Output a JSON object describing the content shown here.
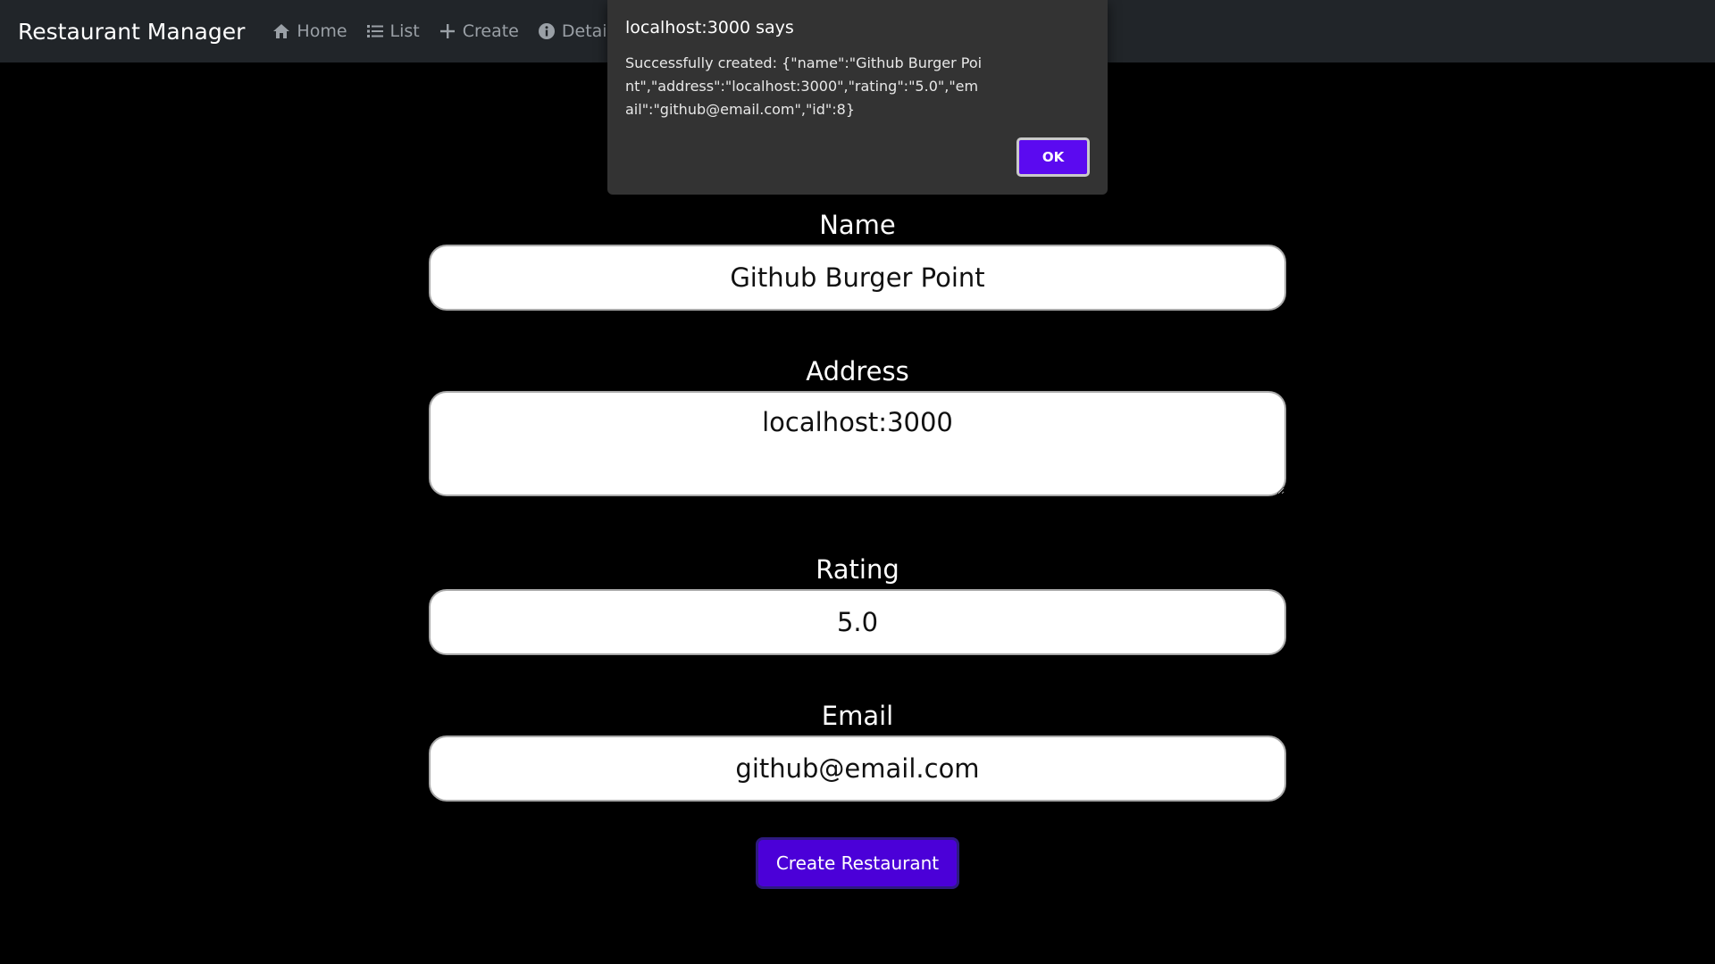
{
  "navbar": {
    "brand": "Restaurant Manager",
    "links": [
      {
        "label": "Home",
        "icon": "home-icon"
      },
      {
        "label": "List",
        "icon": "list-icon"
      },
      {
        "label": "Create",
        "icon": "plus-icon"
      },
      {
        "label": "Details",
        "icon": "info-icon"
      },
      {
        "label": "",
        "icon": "user-icon"
      }
    ]
  },
  "form": {
    "name_label": "Name",
    "name_value": "Github Burger Point",
    "address_label": "Address",
    "address_value": "localhost:3000",
    "rating_label": "Rating",
    "rating_value": "5.0",
    "email_label": "Email",
    "email_value": "github@email.com",
    "submit_label": "Create Restaurant"
  },
  "dialog": {
    "title": "localhost:3000 says",
    "message": "Successfully created: {\"name\":\"Github Burger Point\",\"address\":\"localhost:3000\",\"rating\":\"5.0\",\"email\":\"github@email.com\",\"id\":8}",
    "ok_label": "OK"
  },
  "colors": {
    "page_bg": "#000000",
    "navbar_bg": "#212529",
    "accent": "#4b00d8",
    "dialog_bg": "#333333"
  }
}
